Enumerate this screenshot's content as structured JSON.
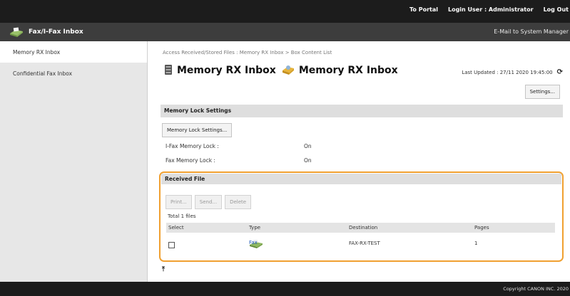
{
  "top_bar": {
    "portal_link": "To Portal",
    "login_user": "Login User : Administrator",
    "logout": "Log Out"
  },
  "title_bar": {
    "app_title": "Fax/I-Fax Inbox",
    "email_link": "E-Mail to System Manager"
  },
  "sidebar": {
    "items": [
      {
        "label": "Memory RX Inbox",
        "active": true
      },
      {
        "label": "Confidential Fax Inbox",
        "active": false
      }
    ]
  },
  "main": {
    "breadcrumb": "Access Received/Stored Files : Memory RX Inbox > Box Content List",
    "heading_left": "Memory RX Inbox",
    "heading_right": "Memory RX Inbox",
    "last_updated": "Last Updated : 27/11 2020 19:45:00",
    "settings_button": "Settings..."
  },
  "memory_lock": {
    "section_title": "Memory Lock Settings",
    "button": "Memory Lock Settings...",
    "rows": [
      {
        "key": "I-Fax Memory Lock :",
        "value": "On"
      },
      {
        "key": "Fax Memory Lock :",
        "value": "On"
      }
    ]
  },
  "received_file": {
    "section_title": "Received File",
    "buttons": {
      "print": "Print...",
      "send": "Send...",
      "delete": "Delete"
    },
    "total": "Total 1 files",
    "columns": [
      "Select",
      "Type",
      "Destination",
      "Pages"
    ],
    "rows": [
      {
        "type": "Fax",
        "destination": "FAX-RX-TEST",
        "pages": "1"
      }
    ]
  },
  "footer": {
    "copyright": "Copyright CANON INC. 2020"
  }
}
